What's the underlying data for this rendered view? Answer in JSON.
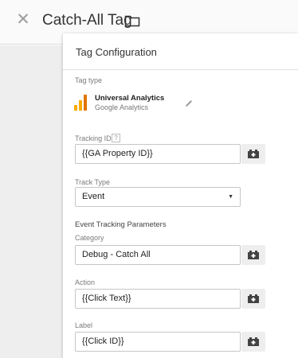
{
  "header": {
    "title": "Catch-All Tag",
    "close_icon": "close-icon",
    "folder_icon": "folder-icon"
  },
  "panel": {
    "title": "Tag Configuration",
    "tag_type": {
      "label": "Tag type",
      "name": "Universal Analytics",
      "provider": "Google Analytics",
      "icon": "google-analytics-icon",
      "edit_icon": "pencil-icon"
    },
    "tracking_id": {
      "label": "Tracking ID",
      "help_glyph": "?",
      "value": "{{GA Property ID}}"
    },
    "track_type": {
      "label": "Track Type",
      "value": "Event"
    },
    "event_tracking": {
      "heading": "Event Tracking Parameters",
      "category": {
        "label": "Category",
        "value": "Debug - Catch All"
      },
      "action": {
        "label": "Action",
        "value": "{{Click Text}}"
      },
      "label": {
        "label": "Label",
        "value": "{{Click ID}}"
      }
    }
  },
  "colors": {
    "analytics_orange": "#f9ab00",
    "analytics_dark_orange": "#e37400",
    "variable_icon": "#424242"
  }
}
